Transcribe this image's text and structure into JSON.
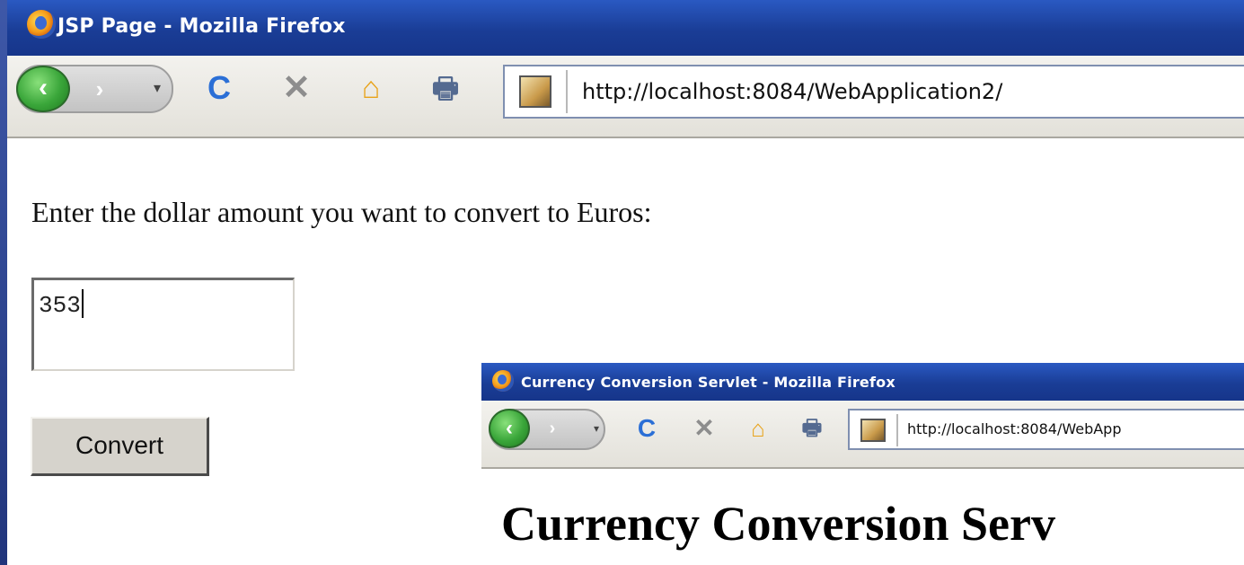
{
  "main_window": {
    "title": "JSP Page - Mozilla Firefox",
    "toolbar": {
      "back_glyph": "‹",
      "forward_glyph": "›",
      "dropdown_glyph": "▾",
      "reload_glyph": "C",
      "stop_glyph": "✕",
      "home_glyph": "⌂",
      "print_glyph": "🖶"
    },
    "address_bar": {
      "url": "http://localhost:8084/WebApplication2/"
    },
    "page": {
      "prompt": "Enter the dollar amount you want to convert to Euros:",
      "amount_value": "353",
      "convert_label": "Convert"
    }
  },
  "second_window": {
    "title": "Currency Conversion Servlet - Mozilla Firefox",
    "toolbar": {
      "back_glyph": "‹",
      "forward_glyph": "›",
      "dropdown_glyph": "▾",
      "reload_glyph": "C",
      "stop_glyph": "✕",
      "home_glyph": "⌂",
      "print_glyph": "🖶"
    },
    "address_bar": {
      "url": "http://localhost:8084/WebApp"
    },
    "page": {
      "heading": "Currency Conversion Serv"
    }
  },
  "colors": {
    "titlebar_blue": "#1a3d96",
    "back_button_green": "#3aa63a",
    "reload_blue": "#2b6fd6",
    "home_orange": "#e8a31a",
    "button_face": "#d6d3cc"
  },
  "icons": {
    "browser_logo": "firefox-logo-icon",
    "site_favicon": "tomcat-favicon-icon"
  }
}
